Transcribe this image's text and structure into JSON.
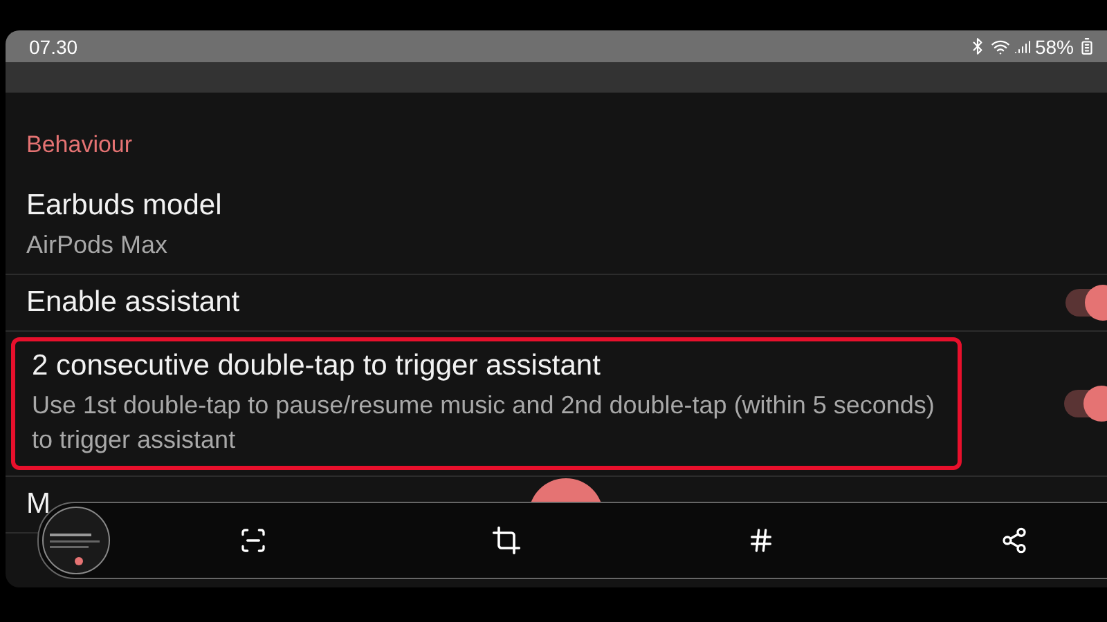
{
  "status_bar": {
    "time": "07.30",
    "battery": "58%"
  },
  "section": {
    "title": "Behaviour"
  },
  "items": [
    {
      "kind": "value",
      "title": "Earbuds model",
      "subtitle": "AirPods Max",
      "highlighted": false
    },
    {
      "kind": "switch",
      "title": "Enable assistant",
      "on": true,
      "highlighted": false
    },
    {
      "kind": "switch",
      "title": "2 consecutive double-tap to trigger assistant",
      "subtitle": "Use 1st double-tap to pause/resume music and 2nd double-tap (within 5 seconds) to trigger assistant",
      "on": true,
      "highlighted": true
    },
    {
      "kind": "value",
      "title": "M",
      "highlighted": false
    }
  ]
}
